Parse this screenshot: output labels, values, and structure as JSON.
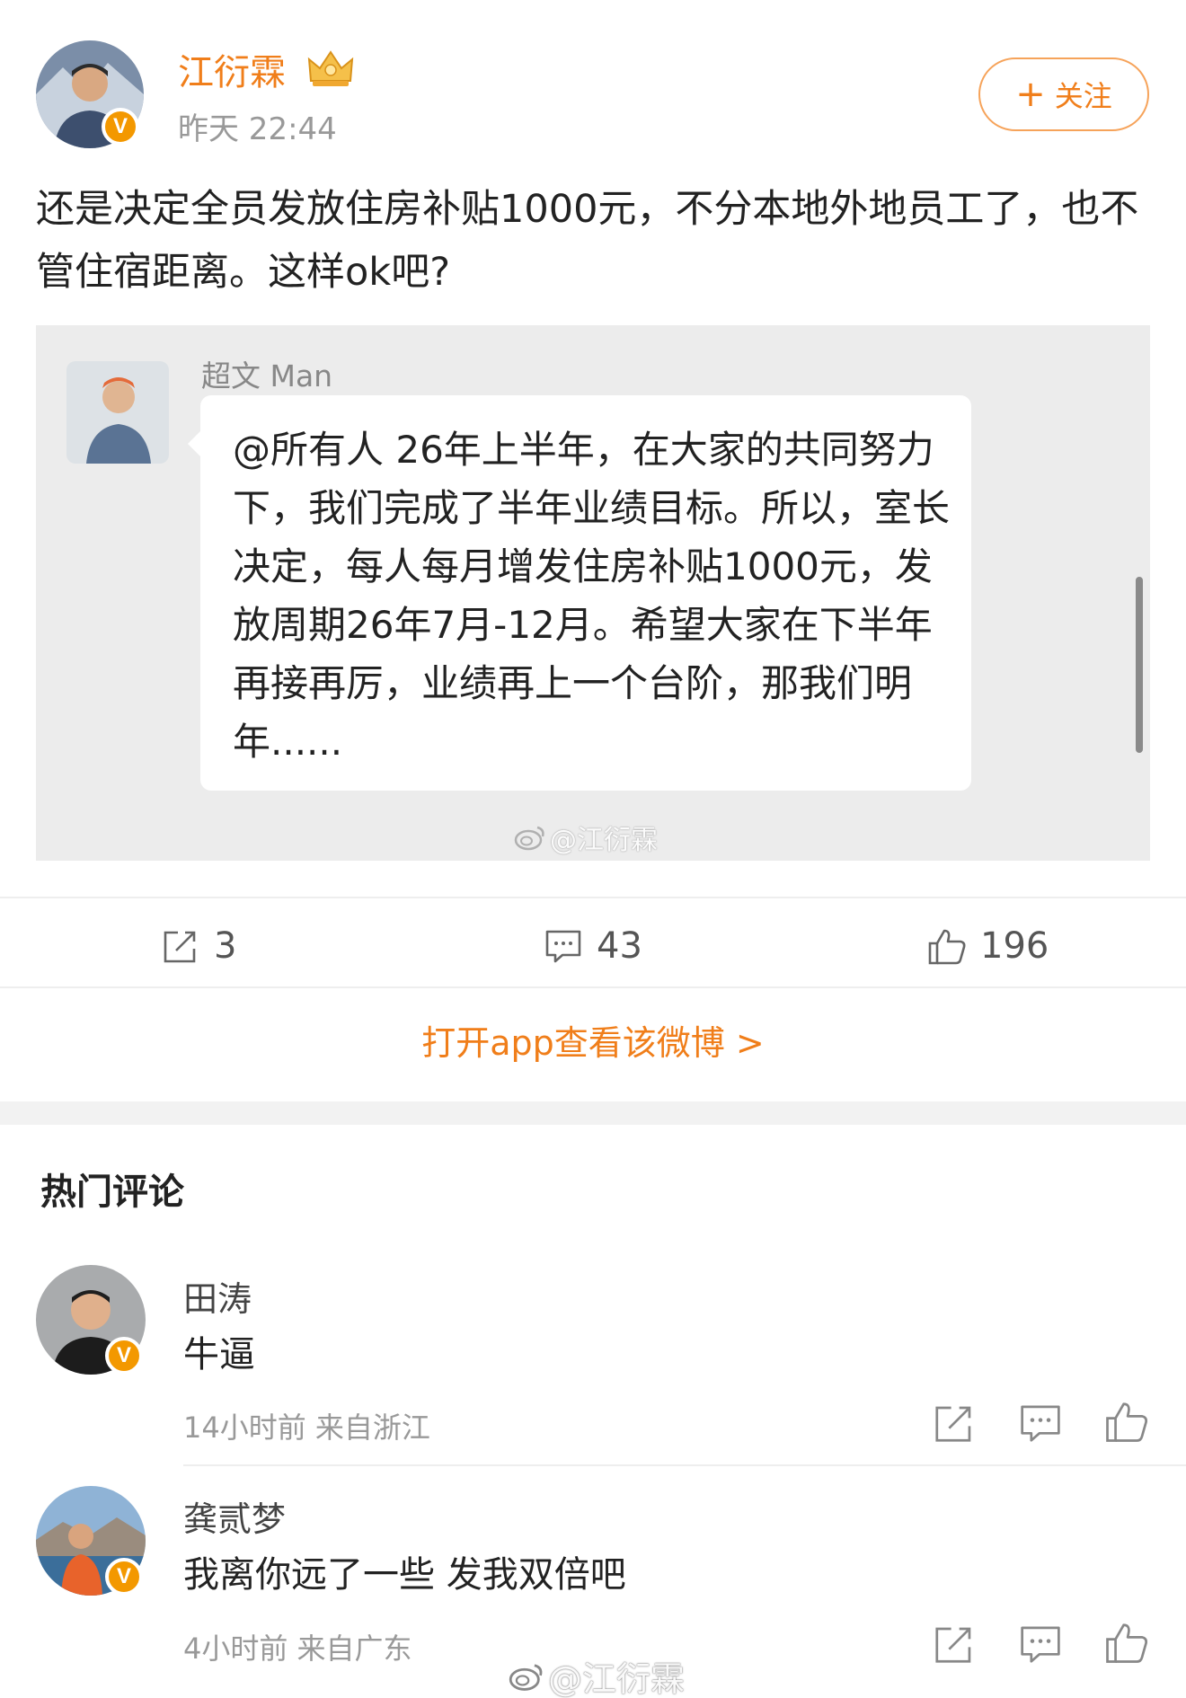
{
  "post": {
    "author": "江衍霖",
    "time": "昨天 22:44",
    "follow_label": "关注",
    "text": "还是决定全员发放住房补贴1000元，不分本地外地员工了，也不管住宿距离。这样ok吧?",
    "verified_badge": "V"
  },
  "repost_card": {
    "name": "超文 Man",
    "message": "@所有人 26年上半年，在大家的共同努力下，我们完成了半年业绩目标。所以，室长决定，每人每月增发住房补贴1000元，发放周期26年7月-12月。希望大家在下半年再接再厉，业绩再上一个台阶，那我们明年......",
    "watermark": "@江衍霖"
  },
  "stats": {
    "reposts": "3",
    "comments": "43",
    "likes": "196"
  },
  "open_app": "打开app查看该微博 >",
  "hot_comments_title": "热门评论",
  "comments": [
    {
      "name": "田涛",
      "text": "牛逼",
      "meta": "14小时前 来自浙江",
      "badge": "V"
    },
    {
      "name": "龚贰梦",
      "text": "我离你远了一些 发我双倍吧",
      "meta": "4小时前 来自广东",
      "badge": "V"
    }
  ],
  "bottom_watermark": "@江衍霖",
  "colors": {
    "accent": "#f07e1a",
    "badge": "#f39800",
    "card_bg": "#ececec"
  },
  "icons": [
    "crown-icon",
    "repost-icon",
    "comment-icon",
    "like-icon",
    "weibo-logo-icon"
  ]
}
